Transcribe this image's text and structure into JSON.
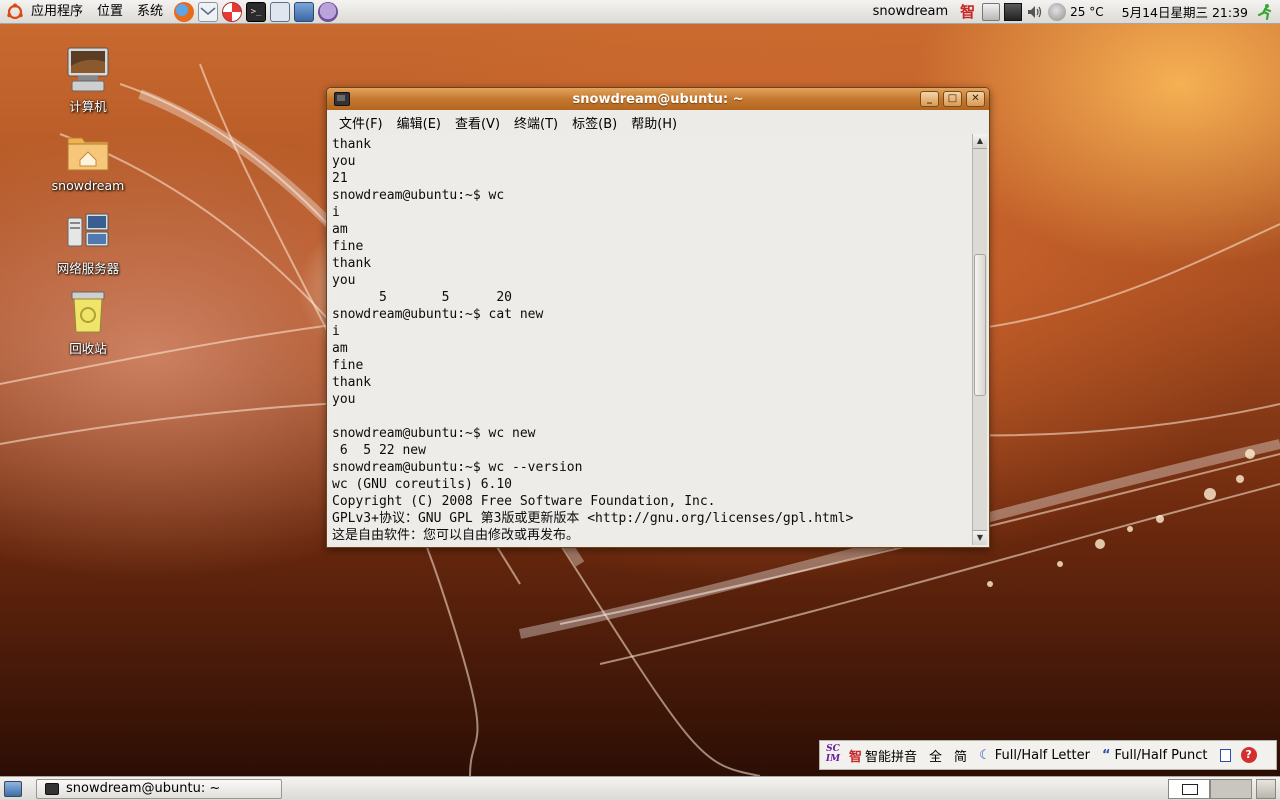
{
  "top_panel": {
    "menus": [
      "应用程序",
      "位置",
      "系统"
    ],
    "launchers": [
      "firefox-icon",
      "mail-icon",
      "help-icon",
      "terminal-icon",
      "keyboard-icon",
      "network-icon",
      "pidgin-icon"
    ],
    "user": "snowdream",
    "weather": "25 °C",
    "clock": "5月14日星期三  21:39"
  },
  "desktop_icons": [
    {
      "id": "computer",
      "label": "计算机"
    },
    {
      "id": "home",
      "label": "snowdream"
    },
    {
      "id": "network",
      "label": "网络服务器"
    },
    {
      "id": "trash",
      "label": "回收站"
    }
  ],
  "window": {
    "title": "snowdream@ubuntu: ~",
    "menus": [
      "文件(F)",
      "编辑(E)",
      "查看(V)",
      "终端(T)",
      "标签(B)",
      "帮助(H)"
    ],
    "terminal_lines": [
      "thank",
      "you",
      "21",
      "snowdream@ubuntu:~$ wc",
      "i",
      "am",
      "fine",
      "thank",
      "you",
      "      5       5      20",
      "snowdream@ubuntu:~$ cat new",
      "i",
      "am",
      "fine",
      "thank",
      "you",
      "",
      "snowdream@ubuntu:~$ wc new",
      " 6  5 22 new",
      "snowdream@ubuntu:~$ wc --version",
      "wc (GNU coreutils) 6.10",
      "Copyright (C) 2008 Free Software Foundation, Inc.",
      "GPLv3+协议：GNU GPL 第3版或更新版本 <http://gnu.org/licenses/gpl.html>",
      "这是自由软件：您可以自由修改或再发布。"
    ]
  },
  "scim": {
    "mode": "智能拼音",
    "full": "全",
    "simplified": "简",
    "letter": "Full/Half Letter",
    "punct": "Full/Half Punct"
  },
  "bottom_panel": {
    "task": "snowdream@ubuntu: ~"
  }
}
